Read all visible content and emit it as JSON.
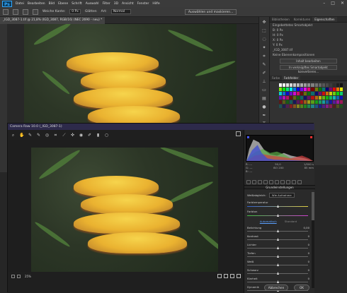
{
  "app": {
    "logo": "Ps",
    "menu": [
      "Datei",
      "Bearbeiten",
      "Bild",
      "Ebene",
      "Schrift",
      "Auswahl",
      "Filter",
      "3D",
      "Ansicht",
      "Fenster",
      "Hilfe"
    ]
  },
  "options": {
    "weiche_kante_label": "Weiche Kante:",
    "weiche_kante_value": "0 Px",
    "glaetten": "Glätten",
    "art_label": "Art:",
    "art_value": "Normal",
    "button": "Auswählen und maskieren..."
  },
  "document": {
    "tab": "_IGD_3087-1.tif @ 21,8% (IGD_3087, RGB/16) (NEC 2690 - neu) *"
  },
  "right_panel": {
    "tabs": [
      "Bibliotheken",
      "Korrekturen",
      "Eigenschaften"
    ],
    "title": "Eingebettetes Smartobjekt",
    "rows": [
      "B: 0 Px",
      "H: 0 Px",
      "X: 0 Px",
      "Y: 0 Px",
      "_IGD_3087.tif",
      "Keine Ebenenkompositionen"
    ],
    "btn1": "Inhalt bearbeiten",
    "btn2": "In verknüpftes Smartobjekt konvertieren...",
    "swatch_tabs": [
      "Farbe",
      "Farbfelder"
    ]
  },
  "camera_raw": {
    "title": "Camera Raw 10.0 (_IGD_3087-1)",
    "histo_info": [
      "R: ---",
      "G: ---",
      "B: ---",
      "f/2,8",
      "1/200 s",
      "ISO 200",
      "85 mm",
      "50,0",
      "1/000 s"
    ],
    "section": "Grundeinstellungen",
    "wb_label": "Weißabgleich:",
    "wb_value": "Wie Aufnahme",
    "temp_label": "Farbtemperatur",
    "tint_label": "Farbton",
    "auto": "Automatisch",
    "standard": "Standard",
    "sliders": [
      {
        "label": "Belichtung",
        "value": "0,00"
      },
      {
        "label": "Kontrast",
        "value": "0"
      },
      {
        "label": "Lichter",
        "value": "0"
      },
      {
        "label": "Tiefen",
        "value": "0"
      },
      {
        "label": "Weiß",
        "value": "0"
      },
      {
        "label": "Schwarz",
        "value": "0"
      },
      {
        "label": "Klarheit",
        "value": "0"
      },
      {
        "label": "Dynamik",
        "value": "0"
      }
    ],
    "zoom": "25%",
    "cancel": "Abbrechen",
    "ok": "OK"
  },
  "colors": {
    "ps_blue": "#31a8ff",
    "title_purple": "#2d2a4a"
  }
}
